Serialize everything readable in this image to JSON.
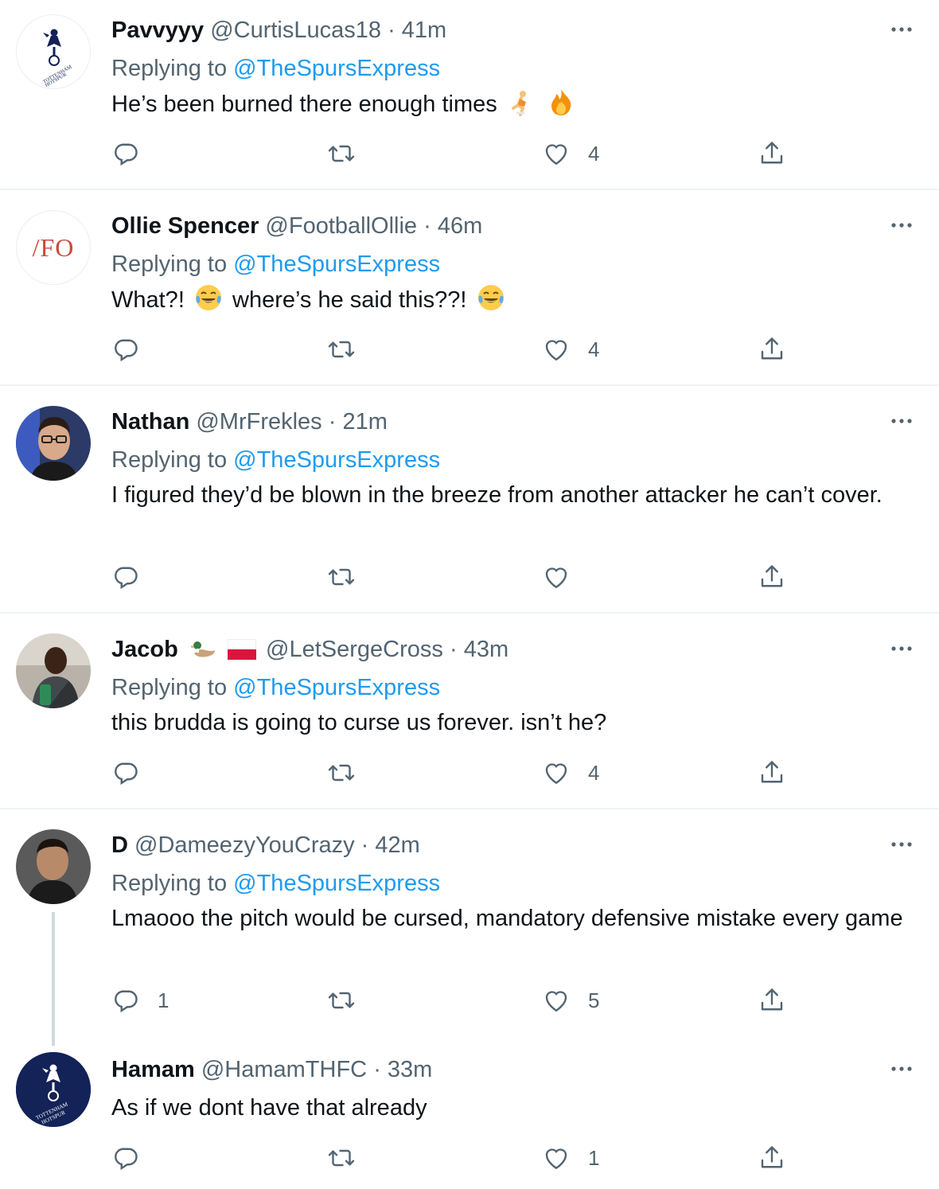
{
  "replying_prefix": "Replying to",
  "tweets": [
    {
      "name": "Pavvyyy",
      "handle": "@CurtisLucas18",
      "separator": "·",
      "time": "41m",
      "replying_to": "@TheSpursExpress",
      "text": "He’s been burned there enough times",
      "text2": "",
      "replies": "",
      "likes": "4",
      "avatar": "tottenham-crest-white"
    },
    {
      "name": "Ollie Spencer",
      "handle": "@FootballOllie",
      "separator": "·",
      "time": "46m",
      "replying_to": "@TheSpursExpress",
      "text": "What?!",
      "text2": "where’s he said this??!",
      "replies": "",
      "likes": "4",
      "avatar_text": "/FO"
    },
    {
      "name": "Nathan",
      "handle": "@MrFrekles",
      "separator": "·",
      "time": "21m",
      "replying_to": "@TheSpursExpress",
      "text": "I figured they’d be blown in the breeze from another attacker he can’t cover.",
      "replies": "",
      "likes": "",
      "avatar": "person-photo"
    },
    {
      "name": "Jacob",
      "handle": "@LetSergeCross",
      "separator": "·",
      "time": "43m",
      "replying_to": "@TheSpursExpress",
      "text": "this brudda is going to curse us forever. isn’t he?",
      "replies": "",
      "likes": "4",
      "avatar": "person-photo"
    },
    {
      "name": "D",
      "handle": "@DameezyYouCrazy",
      "separator": "·",
      "time": "42m",
      "replying_to": "@TheSpursExpress",
      "text": "Lmaooo the pitch would be cursed, mandatory defensive mistake every game",
      "replies": "1",
      "likes": "5",
      "avatar": "person-photo"
    },
    {
      "name": "Hamam",
      "handle": "@HamamTHFC",
      "separator": "·",
      "time": "33m",
      "text": "As if we dont have that already",
      "replies": "",
      "likes": "1",
      "avatar": "tottenham-crest-navy"
    }
  ],
  "colors": {
    "link": "#1d9bf0",
    "secondary": "#536471",
    "text": "#0f1419",
    "divider": "#eff3f4",
    "spurs_navy": "#132257"
  }
}
